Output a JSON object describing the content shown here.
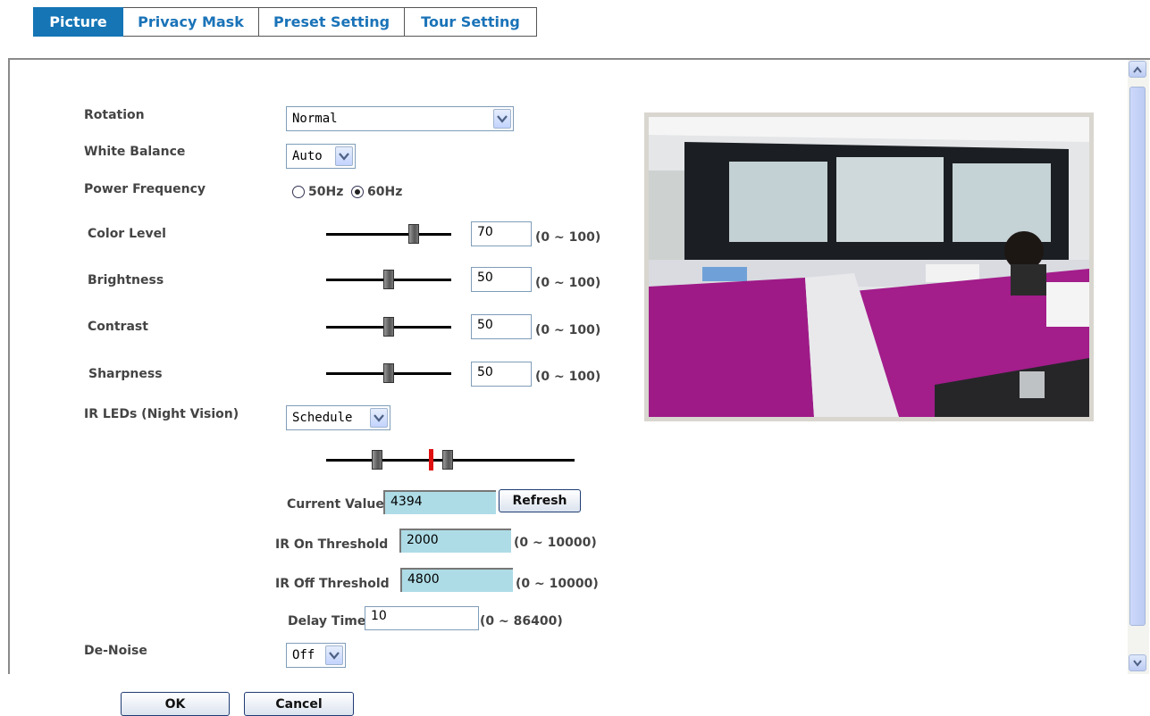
{
  "tabs": [
    {
      "label": "Picture",
      "active": true
    },
    {
      "label": "Privacy Mask",
      "active": false
    },
    {
      "label": "Preset Setting",
      "active": false
    },
    {
      "label": "Tour Setting",
      "active": false
    }
  ],
  "form": {
    "rotation": {
      "label": "Rotation",
      "value": "Normal"
    },
    "white_balance": {
      "label": "White Balance",
      "value": "Auto"
    },
    "power_frequency": {
      "label": "Power Frequency",
      "option_50": "50Hz",
      "option_60": "60Hz",
      "selected": "60Hz"
    },
    "color_level": {
      "label": "Color Level",
      "value": "70",
      "range": "(0 ~ 100)",
      "level": 0.7
    },
    "brightness": {
      "label": "Brightness",
      "value": "50",
      "range": "(0 ~ 100)",
      "level": 0.5
    },
    "contrast": {
      "label": "Contrast",
      "value": "50",
      "range": "(0 ~ 100)",
      "level": 0.5
    },
    "sharpness": {
      "label": "Sharpness",
      "value": "50",
      "range": "(0 ~ 100)",
      "level": 0.5
    },
    "ir_leds": {
      "label": "IR LEDs (Night Vision)",
      "value": "Schedule"
    },
    "current_value": {
      "label": "Current Value",
      "value": "4394",
      "refresh_label": "Refresh"
    },
    "ir_on_threshold": {
      "label": "IR On Threshold",
      "value": "2000",
      "range": "(0 ~ 10000)"
    },
    "ir_off_threshold": {
      "label": "IR Off Threshold",
      "value": "4800",
      "range": "(0 ~ 10000)"
    },
    "delay_time": {
      "label": "Delay Time",
      "value": "10",
      "range": "(0 ~ 86400)"
    },
    "de_noise": {
      "label": "De-Noise",
      "value": "Off"
    }
  },
  "buttons": {
    "ok": "OK",
    "cancel": "Cancel"
  },
  "icons": {
    "dropdown": "chevron-down-icon",
    "scroll_up": "arrow-up-icon",
    "scroll_down": "arrow-down-icon"
  },
  "colors": {
    "active_tab": "#1575b5",
    "tab_text": "#1a73b8",
    "threshold_field": "#aedce6",
    "ir_marker": "#e01010"
  }
}
